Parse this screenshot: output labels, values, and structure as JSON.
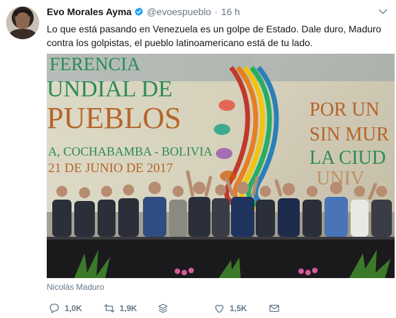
{
  "tweet": {
    "author_name": "Evo Morales Ayma",
    "handle": "@evoespueblo",
    "separator": "·",
    "time": "16 h",
    "text": "Lo que está pasando en Venezuela es un golpe de Estado. Dale duro, Maduro contra los golpistas, el pueblo latinoamericano está de tu lado."
  },
  "media": {
    "banner_lines": [
      "FERENCIA",
      "UNDIAL DE",
      "PUEBLOS"
    ],
    "banner_place": "A, COCHABAMBA - BOLIVIA",
    "banner_date": "21 DE JUNIO DE 2017",
    "right_lines": [
      "POR UN",
      "SIN MUR",
      "LA CIUD",
      "UNIV"
    ],
    "caption": "Nicolás Maduro"
  },
  "actions": {
    "replies": "1,0K",
    "retweets": "1,9K",
    "likes": "1,5K"
  },
  "icons": {
    "verified": "verified-badge-icon",
    "more": "chevron-down-icon",
    "reply": "reply-icon",
    "retweet": "retweet-icon",
    "stack": "stack-icon",
    "like": "heart-icon",
    "dm": "envelope-icon"
  },
  "colors": {
    "verified_blue": "#1da1f2",
    "muted": "#657786",
    "text": "#14171a"
  }
}
